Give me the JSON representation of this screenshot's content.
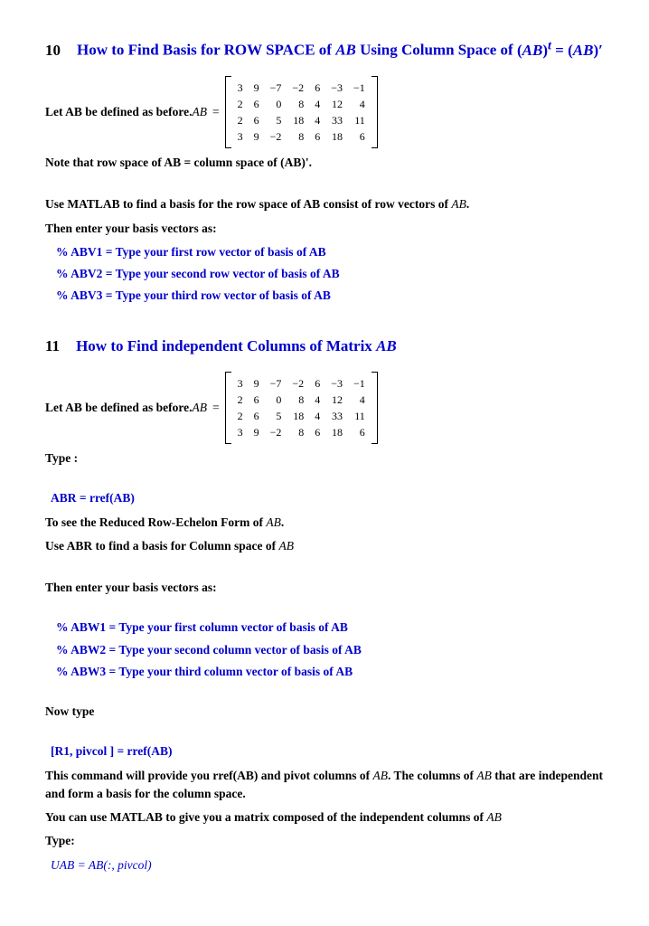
{
  "section10": {
    "number": "10",
    "title_prefix": "How to Find Basis for ROW SPACE of ",
    "title_ab": "AB",
    "title_suffix": " Using Column Space of ",
    "title_math": "(AB)ᵗ = (AB)′",
    "intro": "Let AB be defined as before. ",
    "ab_label": "AB",
    "equals": " = ",
    "matrix": [
      [
        "3",
        "9",
        "−7",
        "−2",
        "6",
        "−3",
        "−1"
      ],
      [
        "2",
        "6",
        "0",
        "8",
        "4",
        "12",
        "4"
      ],
      [
        "2",
        "6",
        "5",
        "18",
        "4",
        "33",
        "11"
      ],
      [
        "3",
        "9",
        "−2",
        "8",
        "6",
        "18",
        "6"
      ]
    ],
    "note": "Note that row space of AB = column space of (AB)'.",
    "use_matlab": "Use MATLAB to find a basis for the row space of AB consist of row vectors of ",
    "use_matlab_ab": "AB",
    "period": ".",
    "then_enter": "Then enter your basis vectors as:",
    "abv1": "% ABV1 = Type your first row vector of basis of AB",
    "abv2": "% ABV2 = Type your second row vector of basis of AB",
    "abv3": "% ABV3 = Type your third row vector of basis of AB"
  },
  "section11": {
    "number": "11",
    "title_prefix": "How to Find independent Columns of Matrix ",
    "title_ab": "AB",
    "intro": "Let AB be defined as before. ",
    "ab_label": "AB",
    "equals": " = ",
    "matrix": [
      [
        "3",
        "9",
        "−7",
        "−2",
        "6",
        "−3",
        "−1"
      ],
      [
        "2",
        "6",
        "0",
        "8",
        "4",
        "12",
        "4"
      ],
      [
        "2",
        "6",
        "5",
        "18",
        "4",
        "33",
        "11"
      ],
      [
        "3",
        "9",
        "−2",
        "8",
        "6",
        "18",
        "6"
      ]
    ],
    "type_label": "Type :",
    "abr_cmd": "ABR = rref(AB)",
    "to_see": "To see the Reduced Row-Echelon Form of ",
    "to_see_ab": "AB",
    "to_see_period": ".",
    "use_abr": "Use ABR to find a basis for Column space of ",
    "use_abr_ab": "AB",
    "then_enter": "Then enter your basis vectors as:",
    "abw1": "% ABW1 = Type your first column vector of basis of AB",
    "abw2": "% ABW2 = Type your second column vector of basis of AB",
    "abw3": "% ABW3 = Type your third column vector of basis of AB",
    "now_type": "Now type",
    "r1_cmd": "[R1, pivcol ] = rref(AB)",
    "this_cmd_1": "This command will provide you rref(AB) and pivot columns of ",
    "this_cmd_ab1": "AB",
    "this_cmd_2": ". The columns of ",
    "this_cmd_ab2": "AB",
    "this_cmd_3": " that are independent and form a basis for the column space.",
    "you_can": "You can use MATLAB to give you a matrix composed of the independent columns of ",
    "you_can_ab": "AB",
    "type2": "Type:",
    "uab_cmd": "UAB = AB(:, pivcol)"
  }
}
